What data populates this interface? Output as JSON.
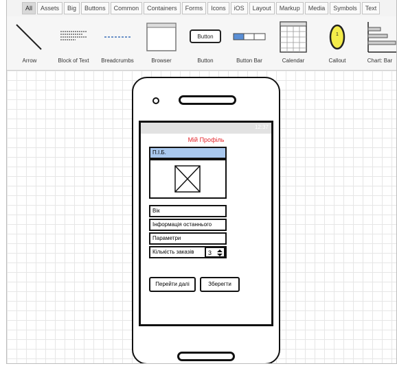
{
  "tabs": [
    "All",
    "Assets",
    "Big",
    "Buttons",
    "Common",
    "Containers",
    "Forms",
    "Icons",
    "iOS",
    "Layout",
    "Markup",
    "Media",
    "Symbols",
    "Text"
  ],
  "library": {
    "items": [
      {
        "label": "Arrow",
        "icon": "arrow-icon"
      },
      {
        "label": "Block of Text",
        "icon": "block-of-text-icon"
      },
      {
        "label": "Breadcrumbs",
        "icon": "breadcrumbs-icon"
      },
      {
        "label": "Browser",
        "icon": "browser-icon"
      },
      {
        "label": "Button",
        "icon": "button-icon",
        "text": "Button"
      },
      {
        "label": "Button Bar",
        "icon": "button-bar-icon"
      },
      {
        "label": "Calendar",
        "icon": "calendar-icon"
      },
      {
        "label": "Callout",
        "icon": "callout-icon",
        "text": "1"
      },
      {
        "label": "Chart: Bar",
        "icon": "chart-bar-icon"
      }
    ]
  },
  "mockup": {
    "status_time": "12:37",
    "title": "Мій Профіль",
    "name_field": "П.І.Б.",
    "age_field": "Вік",
    "info_field": "Інформація останнього",
    "params_field": "Параметри",
    "orders_label": "Кількість заказів",
    "orders_value": "3",
    "next_button": "Перейти далі",
    "save_button": "Зберегти"
  },
  "colors": {
    "title": "#e3262c",
    "selected_field": "#a9c8ee"
  }
}
